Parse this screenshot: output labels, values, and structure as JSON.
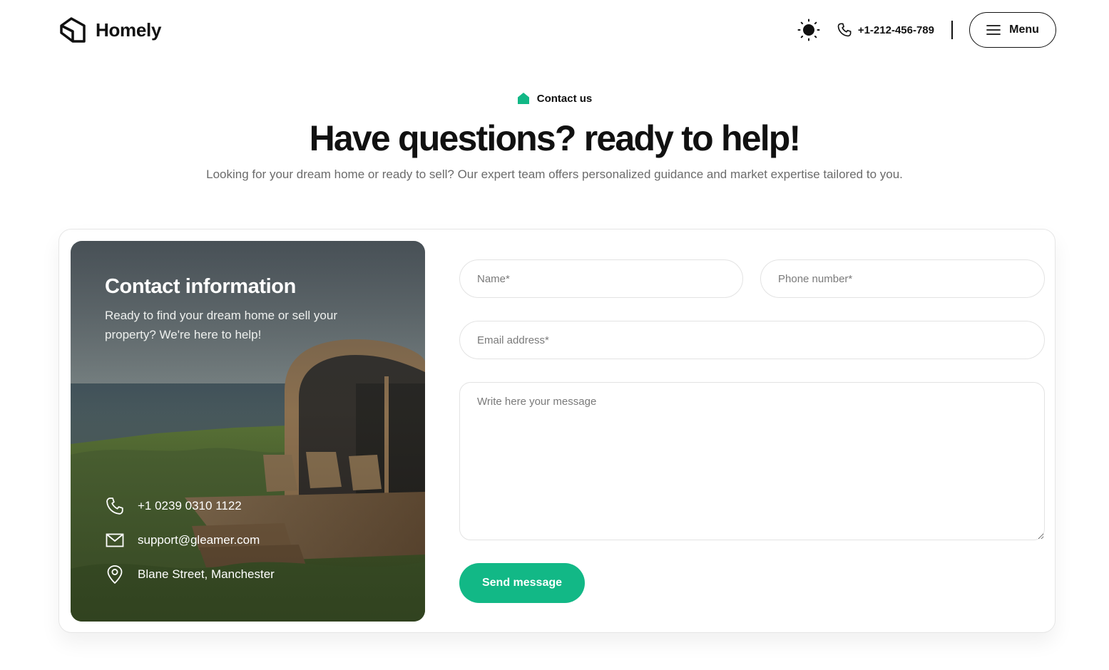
{
  "header": {
    "brand": "Homely",
    "phone": "+1-212-456-789",
    "menu_label": "Menu"
  },
  "hero": {
    "eyebrow": "Contact us",
    "title": "Have questions? ready to help!",
    "subtitle": "Looking for your dream home or ready to sell? Our expert team offers personalized guidance and market expertise tailored to you."
  },
  "contact_info": {
    "title": "Contact information",
    "description": "Ready to find your dream home or sell your property? We're here to help!",
    "phone": "+1 0239 0310 1122",
    "email": "support@gleamer.com",
    "address": "Blane Street, Manchester"
  },
  "form": {
    "name_placeholder": "Name*",
    "phone_placeholder": "Phone number*",
    "email_placeholder": "Email address*",
    "message_placeholder": "Write here your message",
    "submit_label": "Send message"
  },
  "colors": {
    "accent": "#12b886",
    "text": "#111111",
    "muted": "#6b6b6b",
    "border": "#e3e3e3"
  },
  "icons": {
    "brand": "house-logo-icon",
    "theme": "sun-icon",
    "phone": "phone-icon",
    "menu": "hamburger-icon",
    "eyebrow": "house-icon",
    "email": "mail-icon",
    "address": "map-pin-icon"
  }
}
